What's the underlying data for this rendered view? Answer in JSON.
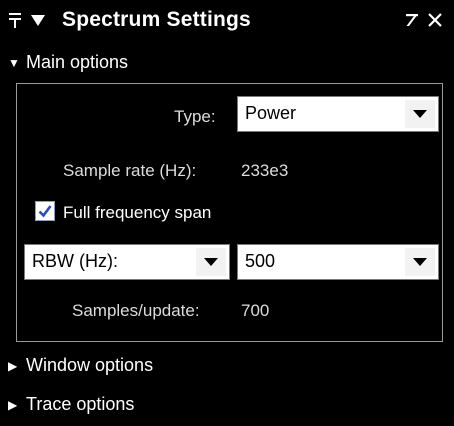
{
  "window": {
    "title": "Spectrum Settings",
    "icons": {
      "pin": "pin-icon",
      "menu": "menu-triangle-icon",
      "undock": "undock-arrow-icon",
      "close": "close-icon"
    }
  },
  "sections": {
    "main": {
      "label": "Main options",
      "expanded": true
    },
    "window": {
      "label": "Window options",
      "expanded": false
    },
    "trace": {
      "label": "Trace options",
      "expanded": false
    }
  },
  "main_options": {
    "type_label": "Type:",
    "type_value": "Power",
    "sample_rate_label": "Sample rate (Hz):",
    "sample_rate_value": "233e3",
    "full_span_label": "Full frequency span",
    "full_span_checked": true,
    "rbw_mode_value": "RBW (Hz):",
    "rbw_value": "500",
    "samples_update_label": "Samples/update:",
    "samples_update_value": "700"
  },
  "colors": {
    "background": "#000000",
    "text": "#ffffff",
    "label_text": "#dcdcdc",
    "box_border": "#9a9a9a",
    "checkmark": "#2a4fb0"
  }
}
